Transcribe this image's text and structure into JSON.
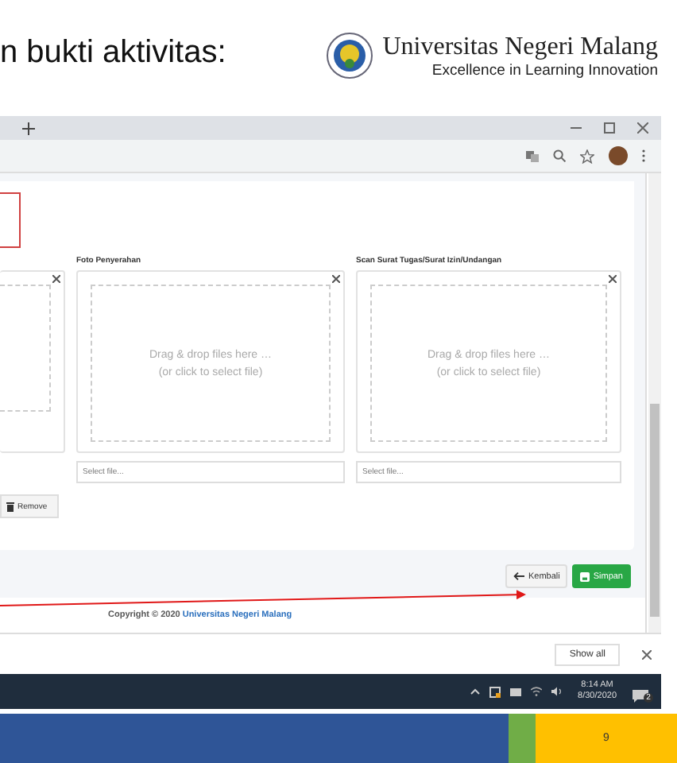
{
  "slide": {
    "title": "n bukti aktivitas:",
    "logo_name": "Universitas Negeri Malang",
    "logo_tagline": "Excellence in Learning Innovation",
    "page_number": "9"
  },
  "form": {
    "uploads": [
      {
        "kind": "preview",
        "remove_label": "Remove"
      },
      {
        "kind": "empty",
        "label": "Foto Penyerahan",
        "drop_text": "Drag & drop files here …",
        "drop_hint": "(or click to select file)",
        "placeholder": "Select file..."
      },
      {
        "kind": "empty",
        "label": "Scan Surat Tugas/Surat Izin/Undangan",
        "drop_text": "Drag & drop files here …",
        "drop_hint": "(or click to select file)",
        "placeholder": "Select file..."
      }
    ],
    "back_button": "Kembali",
    "save_button": "Simpan"
  },
  "footer": {
    "copyright": "Copyright © 2020 ",
    "link": "Universitas Negeri Malang"
  },
  "downloads": {
    "show_all": "Show all"
  },
  "taskbar": {
    "time": "8:14 AM",
    "date": "8/30/2020",
    "notifications": "2"
  }
}
